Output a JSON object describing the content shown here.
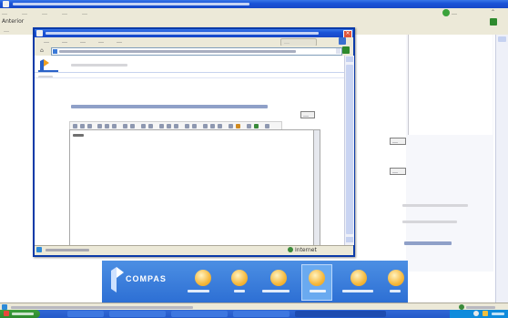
{
  "back_window": {
    "title": "…",
    "menu_items": [
      "…",
      "…",
      "…",
      "…",
      "…"
    ],
    "toolbar_search_label": "…",
    "address": "…",
    "go_label": "…",
    "status": "…",
    "zone": "…"
  },
  "page": {
    "button_1": "…",
    "button_2": "…",
    "right_text_1": "…",
    "right_text_2": "…",
    "blue_link": "…"
  },
  "compas": {
    "logo_text": "COMPAS",
    "items": [
      "…",
      "…",
      "…",
      "…",
      "…",
      "…"
    ],
    "selected_index": 3
  },
  "popup": {
    "title": "…",
    "menu_items": [
      "…",
      "…",
      "…",
      "…",
      "…"
    ],
    "search_label": "…",
    "address": "…",
    "go_label": "…",
    "header_link": "…",
    "question": "…",
    "mini_button": "…",
    "editor_text": "…",
    "status": "…",
    "zone": "Internet"
  },
  "taskbar": {
    "start_label": "…",
    "tasks": [
      "…",
      "…",
      "…",
      "…",
      "…"
    ],
    "time": "…"
  },
  "misc": {
    "back_button": "Anterior"
  },
  "colors": {
    "xp_blue": "#1b54d8",
    "compas_blue": "#2d6fd4",
    "tile_orange": "#f5b73a",
    "taskbar": "#2359c9",
    "start_green": "#2e8a2e"
  }
}
